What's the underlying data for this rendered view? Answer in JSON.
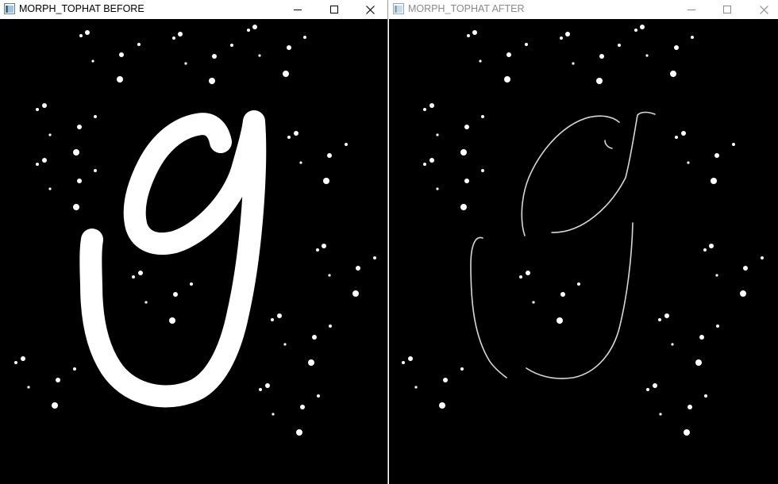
{
  "windows": [
    {
      "title": "MORPH_TOPHAT BEFORE",
      "active": true,
      "controls": [
        "minimize-icon",
        "maximize-icon",
        "close-icon"
      ]
    },
    {
      "title": "MORPH_TOPHAT AFTER",
      "active": false,
      "controls": [
        "minimize-icon",
        "maximize-icon",
        "close-icon"
      ]
    }
  ],
  "colors": {
    "canvas": "#000000",
    "titlebar": "#ffffff",
    "active_title_text": "#000000",
    "inactive_title_text": "#8a8a8a",
    "stroke": "#ffffff"
  }
}
